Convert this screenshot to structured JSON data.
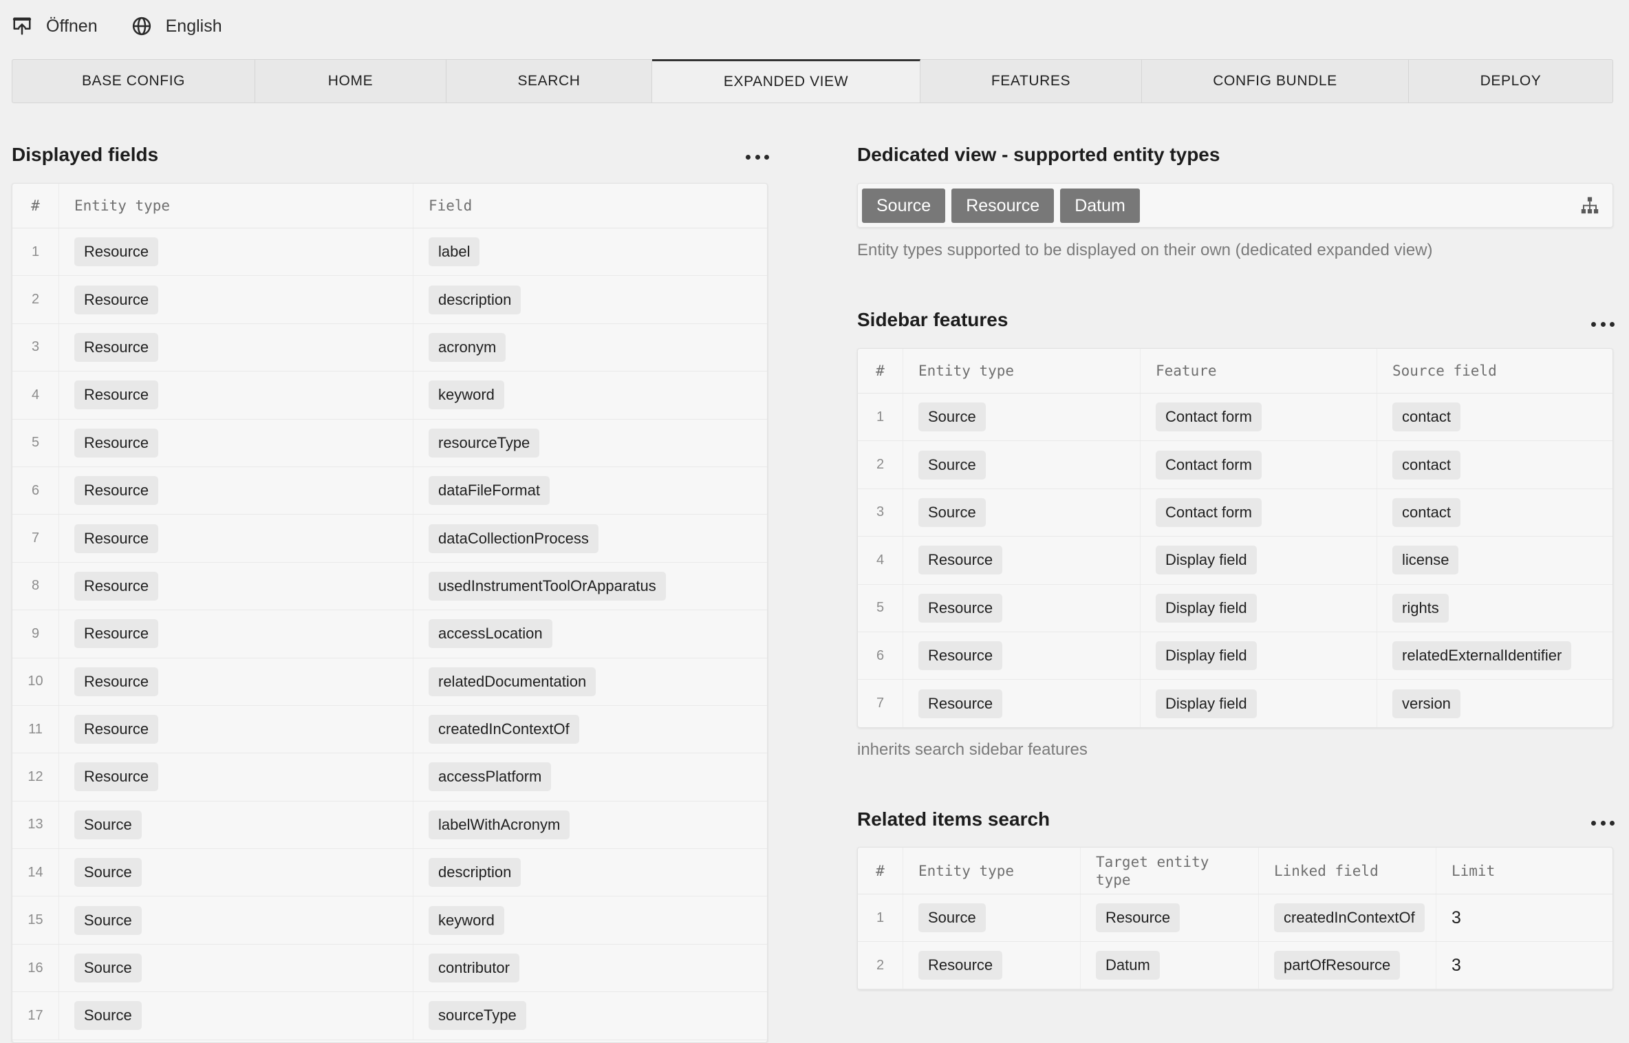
{
  "topbar": {
    "open_label": "Öffnen",
    "language_label": "English"
  },
  "icons": {
    "open": "open-icon",
    "language": "globe-icon",
    "more": "more-icon",
    "entity_picker": "hierarchy-icon"
  },
  "colors": {
    "page_bg": "#f0f0f0",
    "value_chip_bg": "#e8e8e8",
    "entity_chip_bg": "#787878",
    "active_tab_border": "#333333"
  },
  "tabs": [
    {
      "label": "BASE CONFIG",
      "active": false
    },
    {
      "label": "HOME",
      "active": false
    },
    {
      "label": "SEARCH",
      "active": false
    },
    {
      "label": "EXPANDED VIEW",
      "active": true
    },
    {
      "label": "FEATURES",
      "active": false
    },
    {
      "label": "CONFIG BUNDLE",
      "active": false
    },
    {
      "label": "DEPLOY",
      "active": false
    }
  ],
  "displayed_fields": {
    "title": "Displayed fields",
    "columns": [
      "#",
      "Entity type",
      "Field"
    ],
    "rows": [
      {
        "n": "1",
        "entity": "Resource",
        "field": "label"
      },
      {
        "n": "2",
        "entity": "Resource",
        "field": "description"
      },
      {
        "n": "3",
        "entity": "Resource",
        "field": "acronym"
      },
      {
        "n": "4",
        "entity": "Resource",
        "field": "keyword"
      },
      {
        "n": "5",
        "entity": "Resource",
        "field": "resourceType"
      },
      {
        "n": "6",
        "entity": "Resource",
        "field": "dataFileFormat"
      },
      {
        "n": "7",
        "entity": "Resource",
        "field": "dataCollectionProcess"
      },
      {
        "n": "8",
        "entity": "Resource",
        "field": "usedInstrumentToolOrApparatus"
      },
      {
        "n": "9",
        "entity": "Resource",
        "field": "accessLocation"
      },
      {
        "n": "10",
        "entity": "Resource",
        "field": "relatedDocumentation"
      },
      {
        "n": "11",
        "entity": "Resource",
        "field": "createdInContextOf"
      },
      {
        "n": "12",
        "entity": "Resource",
        "field": "accessPlatform"
      },
      {
        "n": "13",
        "entity": "Source",
        "field": "labelWithAcronym"
      },
      {
        "n": "14",
        "entity": "Source",
        "field": "description"
      },
      {
        "n": "15",
        "entity": "Source",
        "field": "keyword"
      },
      {
        "n": "16",
        "entity": "Source",
        "field": "contributor"
      },
      {
        "n": "17",
        "entity": "Source",
        "field": "sourceType"
      }
    ]
  },
  "dedicated_view": {
    "title": "Dedicated view - supported entity types",
    "entity_types": [
      "Source",
      "Resource",
      "Datum"
    ],
    "help": "Entity types supported to be displayed on their own (dedicated expanded view)"
  },
  "sidebar_features": {
    "title": "Sidebar features",
    "columns": [
      "#",
      "Entity type",
      "Feature",
      "Source field"
    ],
    "rows": [
      {
        "n": "1",
        "entity": "Source",
        "feature": "Contact form",
        "source_field": "contact"
      },
      {
        "n": "2",
        "entity": "Source",
        "feature": "Contact form",
        "source_field": "contact"
      },
      {
        "n": "3",
        "entity": "Source",
        "feature": "Contact form",
        "source_field": "contact"
      },
      {
        "n": "4",
        "entity": "Resource",
        "feature": "Display field",
        "source_field": "license"
      },
      {
        "n": "5",
        "entity": "Resource",
        "feature": "Display field",
        "source_field": "rights"
      },
      {
        "n": "6",
        "entity": "Resource",
        "feature": "Display field",
        "source_field": "relatedExternalIdentifier"
      },
      {
        "n": "7",
        "entity": "Resource",
        "feature": "Display field",
        "source_field": "version"
      }
    ],
    "note": "inherits search sidebar features"
  },
  "related_items": {
    "title": "Related items search",
    "columns": [
      "#",
      "Entity type",
      "Target entity type",
      "Linked field",
      "Limit"
    ],
    "rows": [
      {
        "n": "1",
        "entity": "Source",
        "target": "Resource",
        "linked_field": "createdInContextOf",
        "limit": "3"
      },
      {
        "n": "2",
        "entity": "Resource",
        "target": "Datum",
        "linked_field": "partOfResource",
        "limit": "3"
      }
    ]
  }
}
